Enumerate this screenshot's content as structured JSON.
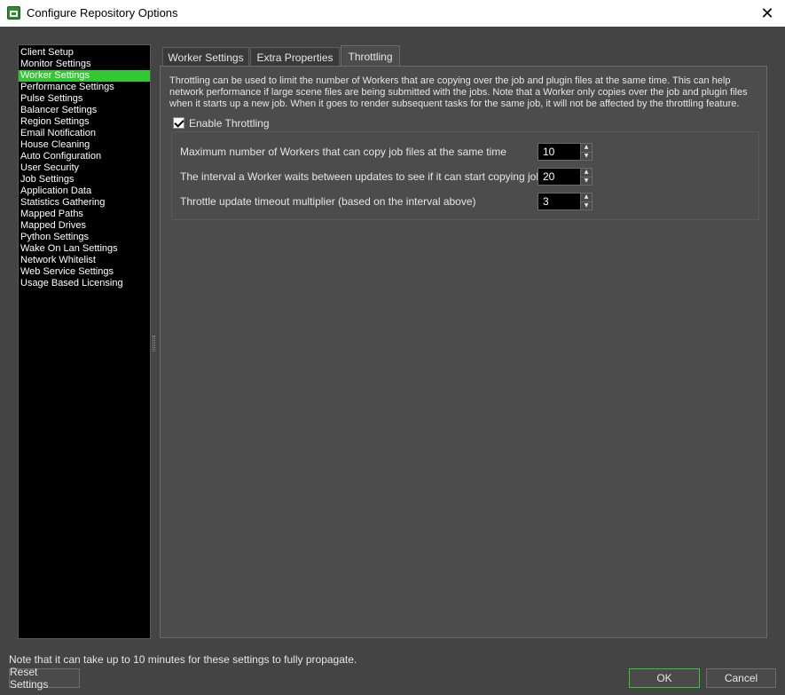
{
  "window": {
    "title": "Configure Repository Options",
    "close_glyph": "✕"
  },
  "sidebar": {
    "items": [
      {
        "label": "Client Setup"
      },
      {
        "label": "Monitor Settings"
      },
      {
        "label": "Worker Settings",
        "selected": true
      },
      {
        "label": "Performance Settings"
      },
      {
        "label": "Pulse Settings"
      },
      {
        "label": "Balancer Settings"
      },
      {
        "label": "Region Settings"
      },
      {
        "label": "Email Notification"
      },
      {
        "label": "House Cleaning"
      },
      {
        "label": "Auto Configuration"
      },
      {
        "label": "User Security"
      },
      {
        "label": "Job Settings"
      },
      {
        "label": "Application Data"
      },
      {
        "label": "Statistics Gathering"
      },
      {
        "label": "Mapped Paths"
      },
      {
        "label": "Mapped Drives"
      },
      {
        "label": "Python Settings"
      },
      {
        "label": "Wake On Lan Settings"
      },
      {
        "label": "Network Whitelist"
      },
      {
        "label": "Web Service Settings"
      },
      {
        "label": "Usage Based Licensing"
      }
    ]
  },
  "tabs": [
    {
      "label": "Worker Settings",
      "active": false
    },
    {
      "label": "Extra Properties",
      "active": false
    },
    {
      "label": "Throttling",
      "active": true
    }
  ],
  "throttling": {
    "description": "Throttling can be used to limit the number of Workers that are copying over the job and plugin files at the same time. This can help network performance if large scene files are being submitted with the jobs. Note that a Worker only copies over the job and plugin files when it starts up a new job. When it goes to render subsequent tasks for the same job, it will not be affected by the throttling feature.",
    "enable_label": "Enable Throttling",
    "enabled": true,
    "settings": [
      {
        "label": "Maximum number of Workers that can copy job files at the same time",
        "value": "10"
      },
      {
        "label": "The interval a Worker waits between updates to see if it can start copying job files",
        "value": "20"
      },
      {
        "label": "Throttle update timeout multiplier (based on the interval above)",
        "value": "3"
      }
    ]
  },
  "footer": {
    "note": "Note that it can take up to 10 minutes for these settings to fully propagate.",
    "reset_label": "Reset Settings",
    "ok_label": "OK",
    "cancel_label": "Cancel"
  },
  "colors": {
    "accent": "#32c832",
    "panel_bg": "#4c4c4c",
    "window_bg": "#444444",
    "list_bg": "#000000"
  }
}
